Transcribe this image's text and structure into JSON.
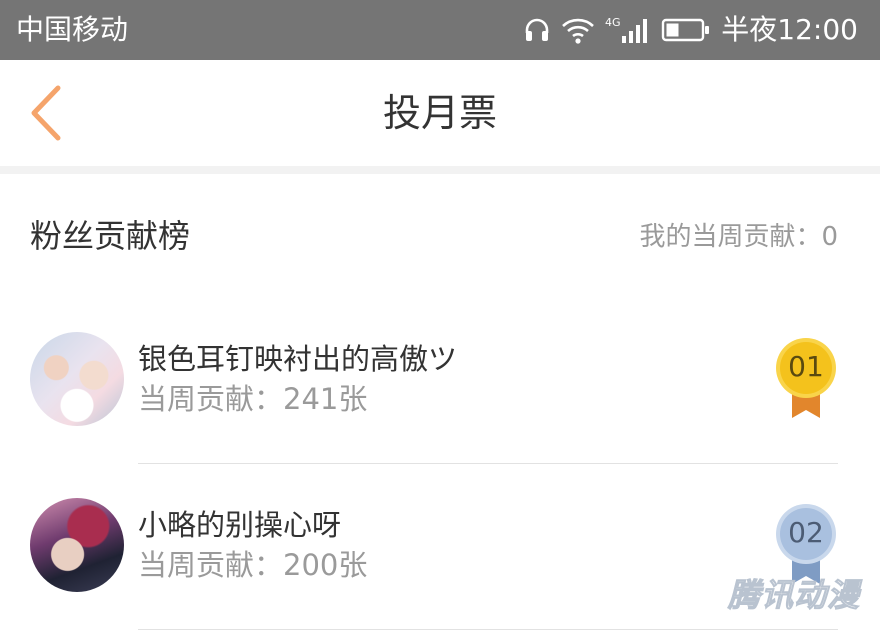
{
  "status_bar": {
    "carrier": "中国移动",
    "network": "4G",
    "time": "半夜12:00",
    "icons": [
      "headset-icon",
      "wifi-icon",
      "cellular-4g-icon",
      "battery-icon"
    ]
  },
  "title_bar": {
    "title": "投月票",
    "back_icon": "chevron-left-icon"
  },
  "section": {
    "title": "粉丝贡献榜",
    "my_contribution": "我的当周贡献：0"
  },
  "fans": [
    {
      "rank": "01",
      "medal": "gold",
      "name": "银色耳钉映衬出的高傲ツ",
      "contribution": "当周贡献：241张"
    },
    {
      "rank": "02",
      "medal": "silver",
      "name": "小略的别操心呀",
      "contribution": "当周贡献：200张"
    }
  ],
  "watermark": "腾讯动漫",
  "colors": {
    "status_bar_bg": "#757575",
    "accent_orange": "#f5a46b",
    "gold_medal": "#f4c21c",
    "silver_medal": "#a9c0df",
    "text_primary": "#333333",
    "text_secondary": "#9a9a9a"
  }
}
